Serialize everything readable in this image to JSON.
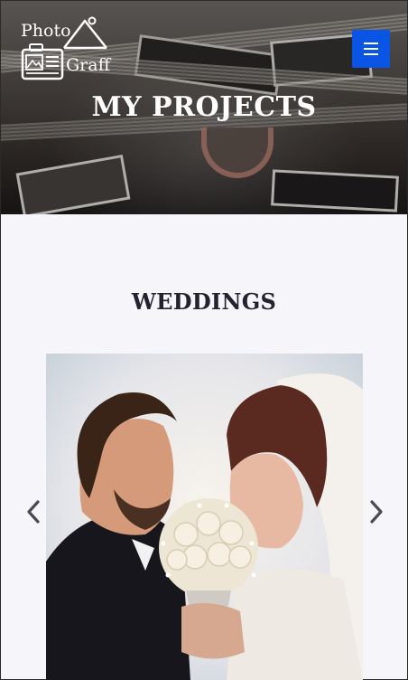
{
  "header": {
    "logo": {
      "line1": "Photo",
      "line2": "Graff"
    },
    "menu_button": {
      "icon": "hamburger-menu-icon",
      "color": "#0a55e6"
    }
  },
  "hero": {
    "title": "MY PROJECTS"
  },
  "section": {
    "title": "WEDDINGS",
    "carousel": {
      "prev_icon": "chevron-left-icon",
      "next_icon": "chevron-right-icon",
      "slide_icon": "wedding-couple-photo"
    }
  },
  "colors": {
    "page_background": "#f6f5f9",
    "heading": "#222231",
    "accent": "#0a55e6"
  }
}
